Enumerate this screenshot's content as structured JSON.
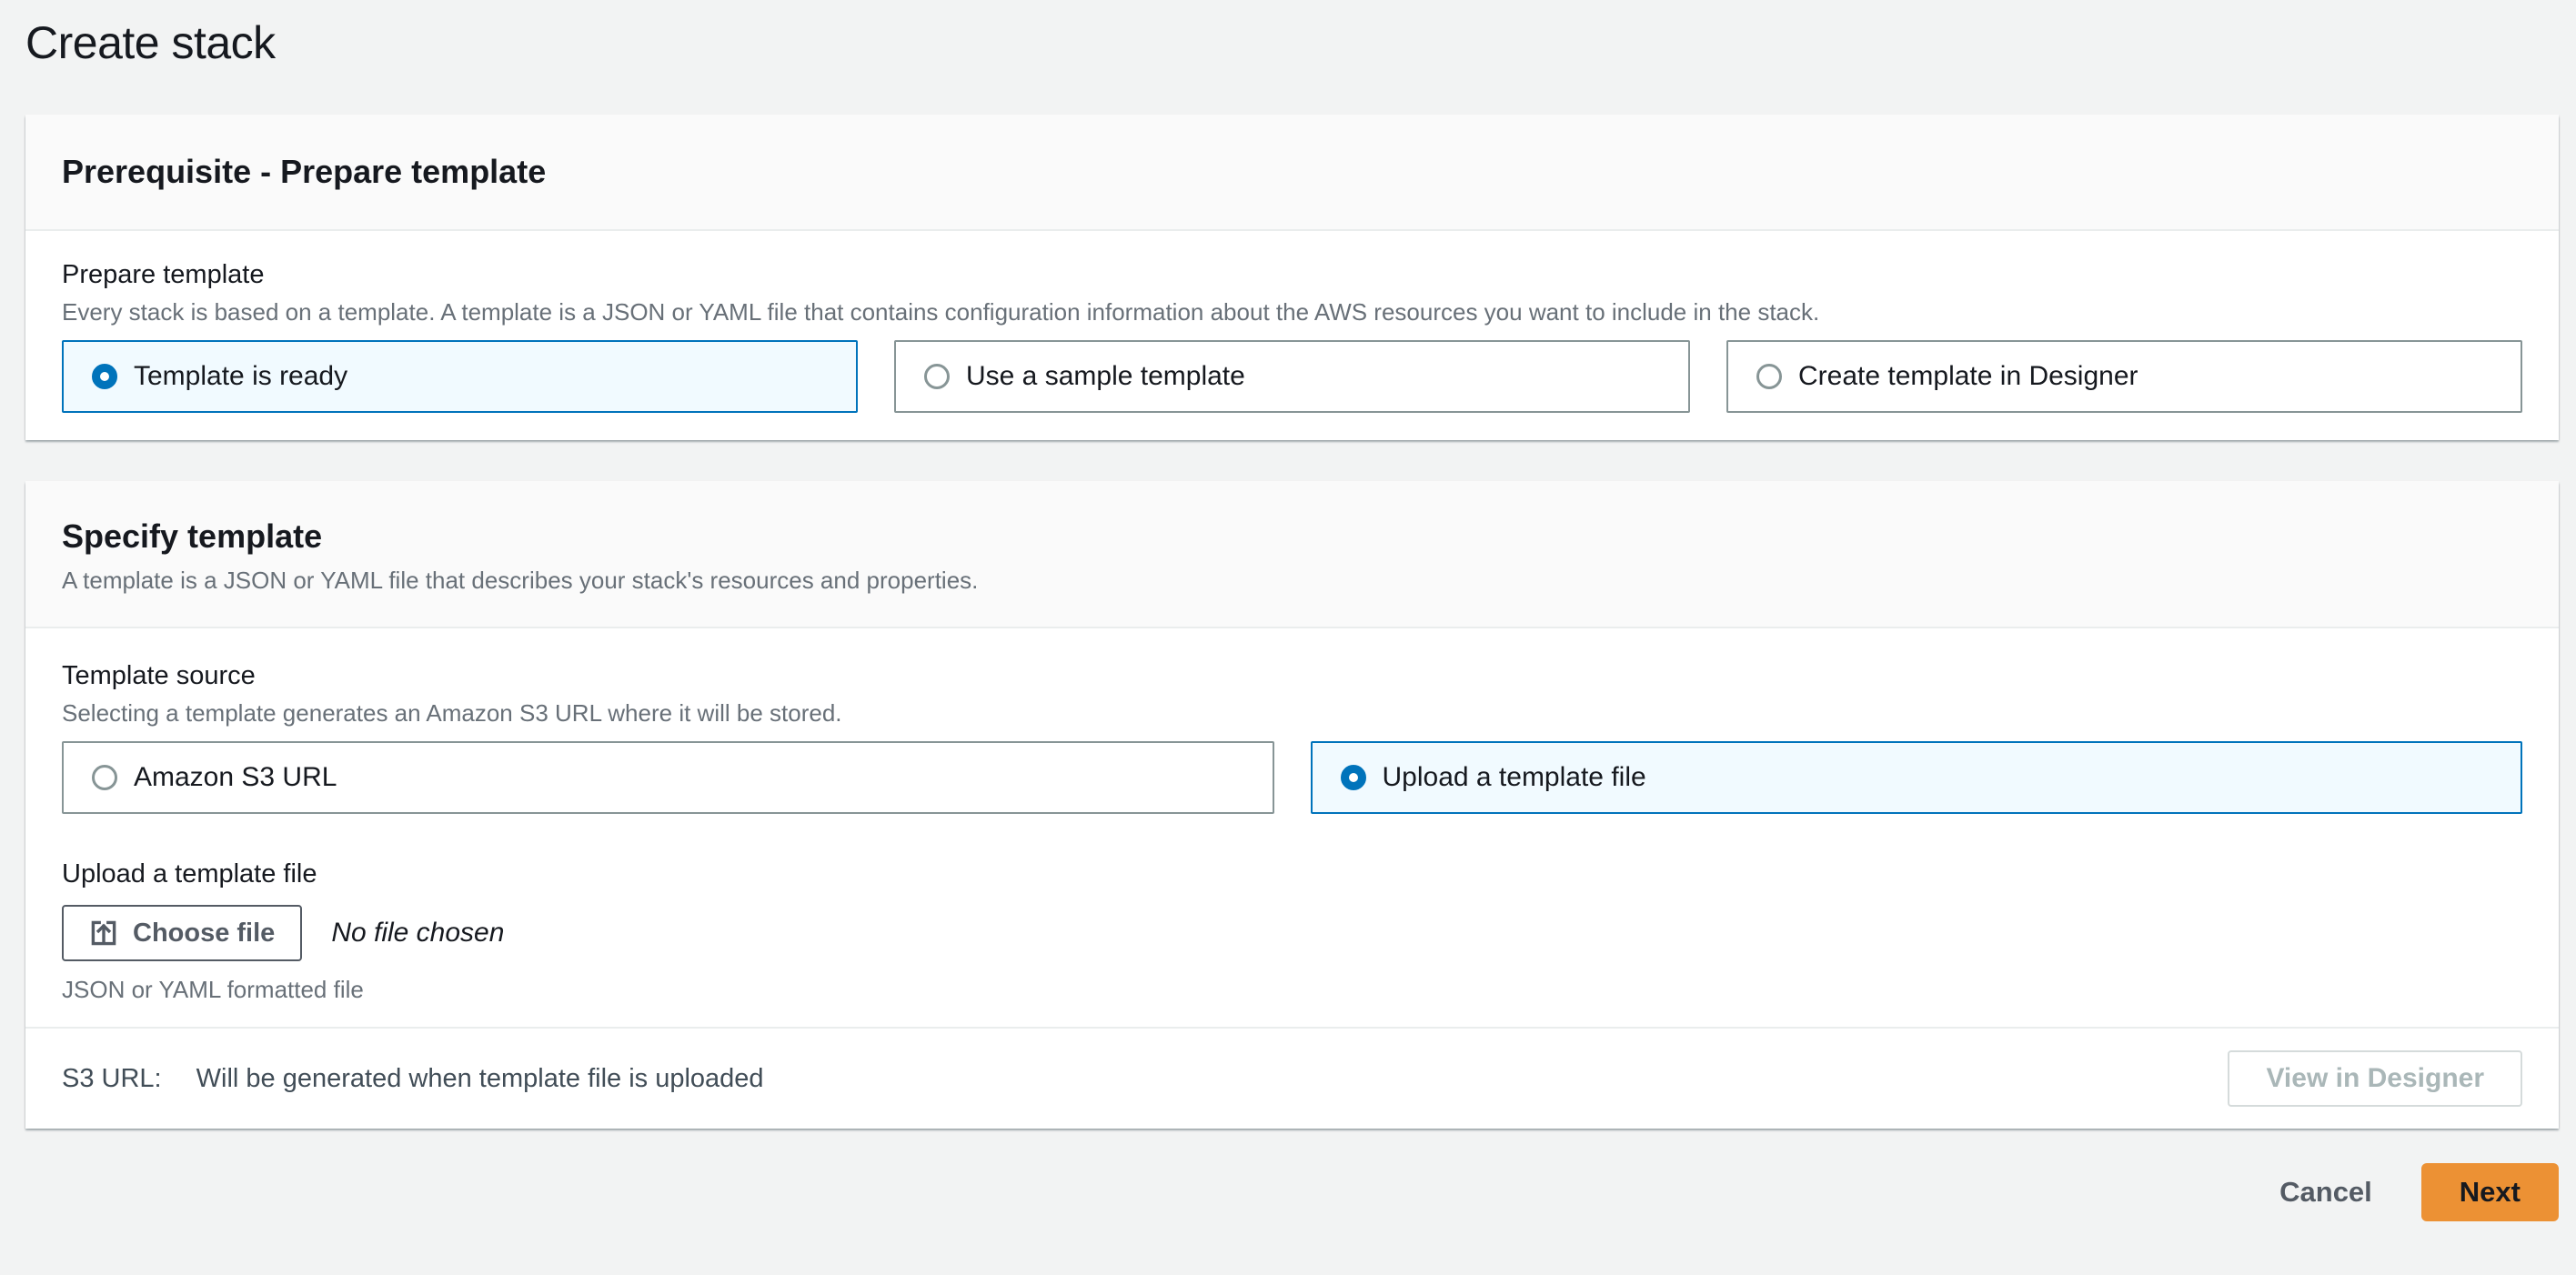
{
  "page": {
    "title": "Create stack"
  },
  "colors": {
    "page_background": "#f2f3f3",
    "card_background": "#ffffff",
    "card_header_background": "#fafafa",
    "divider": "#eaeded",
    "accent_blue": "#0073bb",
    "selected_tile_background": "#f1faff",
    "unselected_tile_border": "#879596",
    "text_primary": "#16191f",
    "text_secondary": "#687078",
    "button_border_gray": "#545b64",
    "disabled_text": "#aab7b8",
    "disabled_border": "#d5dbdb",
    "primary_button_orange": "#ec9134"
  },
  "prerequisite_card": {
    "title": "Prerequisite - Prepare template",
    "prepare_template": {
      "label": "Prepare template",
      "description": "Every stack is based on a template. A template is a JSON or YAML file that contains configuration information about the AWS resources you want to include in the stack.",
      "options": [
        {
          "label": "Template is ready",
          "selected": true
        },
        {
          "label": "Use a sample template",
          "selected": false
        },
        {
          "label": "Create template in Designer",
          "selected": false
        }
      ]
    }
  },
  "specify_card": {
    "title": "Specify template",
    "description": "A template is a JSON or YAML file that describes your stack's resources and properties.",
    "template_source": {
      "label": "Template source",
      "description": "Selecting a template generates an Amazon S3 URL where it will be stored.",
      "options": [
        {
          "label": "Amazon S3 URL",
          "selected": false
        },
        {
          "label": "Upload a template file",
          "selected": true
        }
      ]
    },
    "upload": {
      "label": "Upload a template file",
      "choose_file_label": "Choose file",
      "file_status": "No file chosen",
      "constraint": "JSON or YAML formatted file"
    },
    "footer": {
      "s3_label": "S3 URL:",
      "s3_value": "Will be generated when template file is uploaded",
      "view_in_designer_label": "View in Designer"
    }
  },
  "actions": {
    "cancel_label": "Cancel",
    "next_label": "Next"
  }
}
